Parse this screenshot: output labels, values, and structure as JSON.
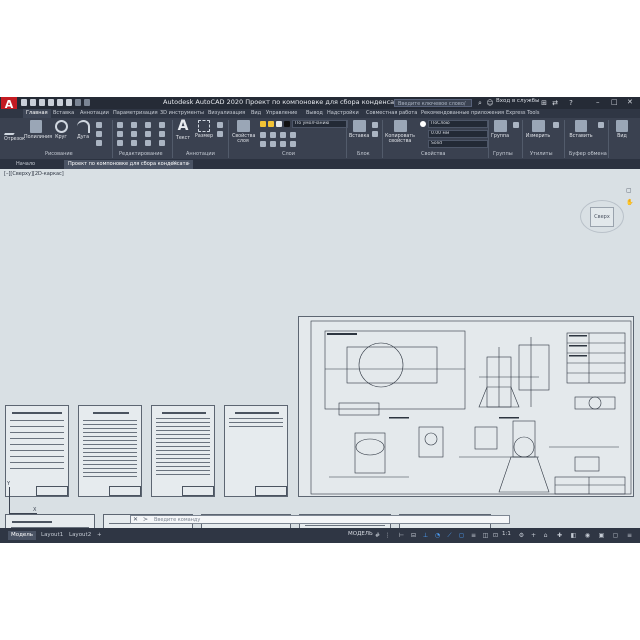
{
  "titlebar": {
    "logo": "A",
    "title": "Autodesk AutoCAD 2020  Проект по компоновке для сбора конденсата.dwg",
    "search_placeholder": "Введите ключевое слово/фразу",
    "signin": "Вход в службы",
    "window_controls": [
      "–",
      "□",
      "✕"
    ]
  },
  "ribbon_tabs": [
    "Главная",
    "Вставка",
    "Аннотации",
    "Параметризация",
    "3D инструменты",
    "Визуализация",
    "Вид",
    "Управление",
    "Вывод",
    "Надстройки",
    "Совместная работа",
    "Рекомендованные приложения",
    "Express Tools"
  ],
  "ribbon": {
    "draw": {
      "line": "Отрезок",
      "polyline": "Полилиния",
      "circle": "Круг",
      "arc": "Дуга",
      "footer": "Рисование"
    },
    "modify": {
      "footer": "Редактирование"
    },
    "annotation": {
      "text": "Текст",
      "dimension": "Размер",
      "footer": "Аннотации"
    },
    "layers": {
      "properties": "Свойства слоя",
      "current": "По умолчанию",
      "footer": "Слои"
    },
    "block": {
      "insert": "Вставка",
      "footer": "Блок"
    },
    "properties": {
      "match": "Копировать свойства",
      "color": "ПоСлою",
      "lineweight": "0.00 мм",
      "linetype": "Solid",
      "footer": "Свойства"
    },
    "groups": {
      "group": "Группа",
      "footer": "Группы"
    },
    "utilities": {
      "measure": "Измерить",
      "footer": "Утилиты"
    },
    "clipboard": {
      "paste": "Вставить",
      "footer": "Буфер обмена"
    },
    "view": {
      "base": "Вид"
    }
  },
  "file_tabs": {
    "start": "Начало",
    "active": "Проект по компоновке для сбора конденсата",
    "add": "+"
  },
  "canvas": {
    "view_label": "[–][Сверху][2D-каркас]",
    "viewcube": "Сверх",
    "ucs_x": "X",
    "ucs_y": "Y",
    "command_placeholder": "Введите команду"
  },
  "statusbar": {
    "tabs": [
      "Модель",
      "Layout1",
      "Layout2"
    ],
    "add": "+",
    "model": "МОДЕЛЬ",
    "scale": "1:1"
  },
  "colors": {
    "accent": "#c41b22",
    "dark": "#2b3240",
    "canvas": "#d9e0e4",
    "active_blue": "#4ea3ff"
  }
}
